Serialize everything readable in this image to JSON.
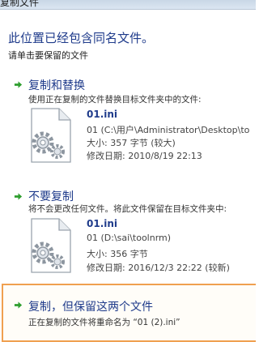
{
  "window": {
    "title": "复制文件"
  },
  "header": {
    "heading": "此位置已经包含同名文件。",
    "instruction": "请单击要保留的文件"
  },
  "options": [
    {
      "title": "复制和替换",
      "description": "使用正在复制的文件替换目标文件夹中的文件:",
      "file": {
        "name": "01.ini",
        "path": "01 (C:\\用户\\Administrator\\Desktop\\to",
        "size": "大小: 357 字节 (较大)",
        "modified": "修改日期: 2010/8/19 22:13"
      }
    },
    {
      "title": "不要复制",
      "description": "将不会更改任何文件。将此文件保留在目标文件夹中:",
      "file": {
        "name": "01.ini",
        "path": "01 (D:\\sai\\toolnrm)",
        "size": "大小: 356 字节",
        "modified": "修改日期: 2016/12/3 22:22 (较新)"
      }
    },
    {
      "title": "复制，但保留这两个文件",
      "description": "正在复制的文件将重命名为 “01 (2).ini”"
    }
  ],
  "colors": {
    "heading": "#1f3b8b",
    "arrow": "#2e9e2e",
    "highlight_border": "#f0a050"
  },
  "icons": {
    "option_arrow": "green-arrow-icon",
    "file": "settings-file-icon"
  }
}
